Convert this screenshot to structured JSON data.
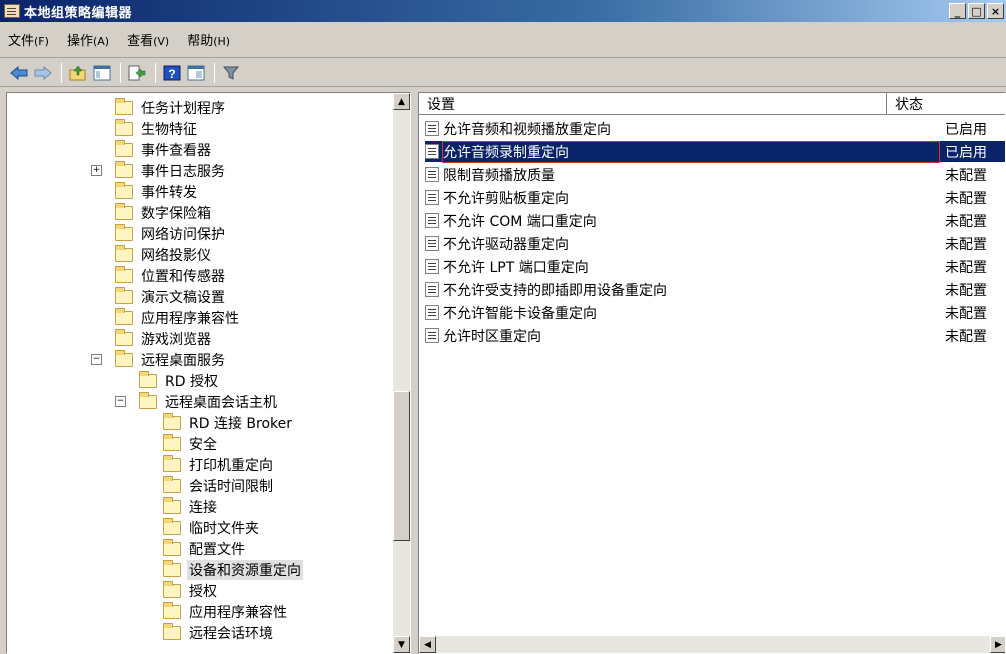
{
  "window": {
    "title": "本地组策略编辑器",
    "buttons": [
      "_",
      "□",
      "×"
    ]
  },
  "menu": [
    {
      "label": "文件",
      "key": "(F)"
    },
    {
      "label": "操作",
      "key": "(A)"
    },
    {
      "label": "查看",
      "key": "(V)"
    },
    {
      "label": "帮助",
      "key": "(H)"
    }
  ],
  "toolbar": {
    "icons": [
      "back-arrow-icon",
      "forward-arrow-icon",
      "up-folder-icon",
      "show-hide-tree-icon",
      "export-list-icon",
      "help-icon",
      "properties-icon",
      "filter-icon"
    ]
  },
  "tree": [
    {
      "label": "任务计划程序",
      "level": 4
    },
    {
      "label": "生物特征",
      "level": 4
    },
    {
      "label": "事件查看器",
      "level": 4
    },
    {
      "label": "事件日志服务",
      "level": 4,
      "expander": "+"
    },
    {
      "label": "事件转发",
      "level": 4
    },
    {
      "label": "数字保险箱",
      "level": 4
    },
    {
      "label": "网络访问保护",
      "level": 4
    },
    {
      "label": "网络投影仪",
      "level": 4
    },
    {
      "label": "位置和传感器",
      "level": 4
    },
    {
      "label": "演示文稿设置",
      "level": 4
    },
    {
      "label": "应用程序兼容性",
      "level": 4
    },
    {
      "label": "游戏浏览器",
      "level": 4
    },
    {
      "label": "远程桌面服务",
      "level": 4,
      "expander": "−"
    },
    {
      "label": "RD 授权",
      "level": 5
    },
    {
      "label": "远程桌面会话主机",
      "level": 5,
      "expander": "−"
    },
    {
      "label": "RD 连接 Broker",
      "level": 6
    },
    {
      "label": "安全",
      "level": 6
    },
    {
      "label": "打印机重定向",
      "level": 6
    },
    {
      "label": "会话时间限制",
      "level": 6
    },
    {
      "label": "连接",
      "level": 6
    },
    {
      "label": "临时文件夹",
      "level": 6
    },
    {
      "label": "配置文件",
      "level": 6
    },
    {
      "label": "设备和资源重定向",
      "level": 6,
      "selected": true
    },
    {
      "label": "授权",
      "level": 6
    },
    {
      "label": "应用程序兼容性",
      "level": 6
    },
    {
      "label": "远程会话环境",
      "level": 6
    }
  ],
  "list": {
    "columns": [
      "设置",
      "状态"
    ],
    "rows": [
      {
        "setting": "允许音频和视频播放重定向",
        "state": "已启用"
      },
      {
        "setting": "允许音频录制重定向",
        "state": "已启用",
        "selected": true
      },
      {
        "setting": "限制音频播放质量",
        "state": "未配置"
      },
      {
        "setting": "不允许剪贴板重定向",
        "state": "未配置"
      },
      {
        "setting": "不允许 COM 端口重定向",
        "state": "未配置"
      },
      {
        "setting": "不允许驱动器重定向",
        "state": "未配置"
      },
      {
        "setting": "不允许 LPT 端口重定向",
        "state": "未配置"
      },
      {
        "setting": "不允许受支持的即插即用设备重定向",
        "state": "未配置"
      },
      {
        "setting": "不允许智能卡设备重定向",
        "state": "未配置"
      },
      {
        "setting": "允许时区重定向",
        "state": "未配置"
      }
    ]
  },
  "colors": {
    "title_bar": "#0a246a",
    "selection": "#0a246a",
    "selection_outline": "#e03030",
    "window_bg": "#d4d0c8"
  }
}
